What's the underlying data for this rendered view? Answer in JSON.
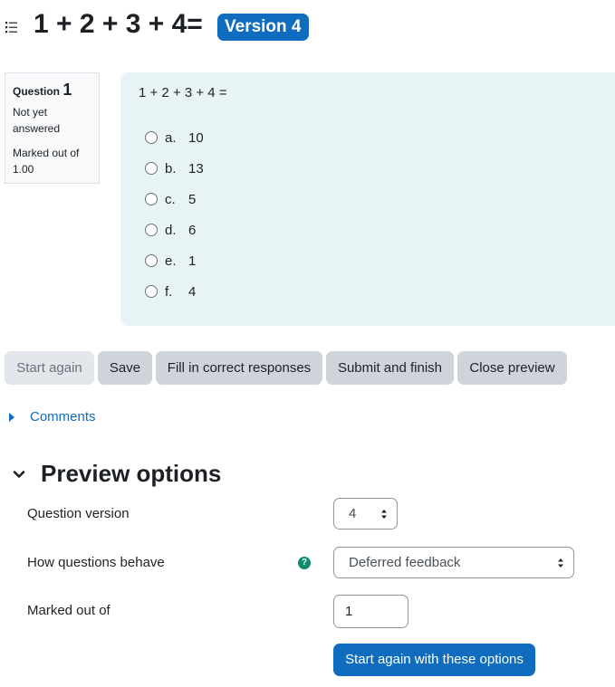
{
  "header": {
    "title": "1 + 2 + 3 + 4=",
    "version_badge": "Version 4"
  },
  "question_info": {
    "label": "Question",
    "number": "1",
    "state": "Not yet answered",
    "grade": "Marked out of 1.00"
  },
  "question": {
    "text": "1 + 2 + 3 + 4 =",
    "answers": [
      {
        "letter": "a.",
        "value": "10"
      },
      {
        "letter": "b.",
        "value": "13"
      },
      {
        "letter": "c.",
        "value": "5"
      },
      {
        "letter": "d.",
        "value": "6"
      },
      {
        "letter": "e.",
        "value": "1"
      },
      {
        "letter": "f.",
        "value": "4"
      }
    ]
  },
  "buttons": {
    "start_again": "Start again",
    "save": "Save",
    "fill_correct": "Fill in correct responses",
    "submit_finish": "Submit and finish",
    "close_preview": "Close preview"
  },
  "comments": {
    "label": "Comments"
  },
  "preview_options": {
    "title": "Preview options",
    "question_version_label": "Question version",
    "question_version_value": "4",
    "behaviour_label": "How questions behave",
    "behaviour_value": "Deferred feedback",
    "marked_label": "Marked out of",
    "marked_value": "1",
    "start_with_options": "Start again with these options"
  },
  "colors": {
    "primary": "#0f6cbf",
    "question_bg": "#e7f3f5",
    "secondary_button": "#ced4da",
    "help_icon": "#0f8a6c"
  },
  "icons": {
    "toc": "list-icon",
    "comments": "caret-right-icon",
    "options": "chevron-down-icon",
    "help": "question-circle-icon",
    "select": "sort-arrows-icon"
  }
}
